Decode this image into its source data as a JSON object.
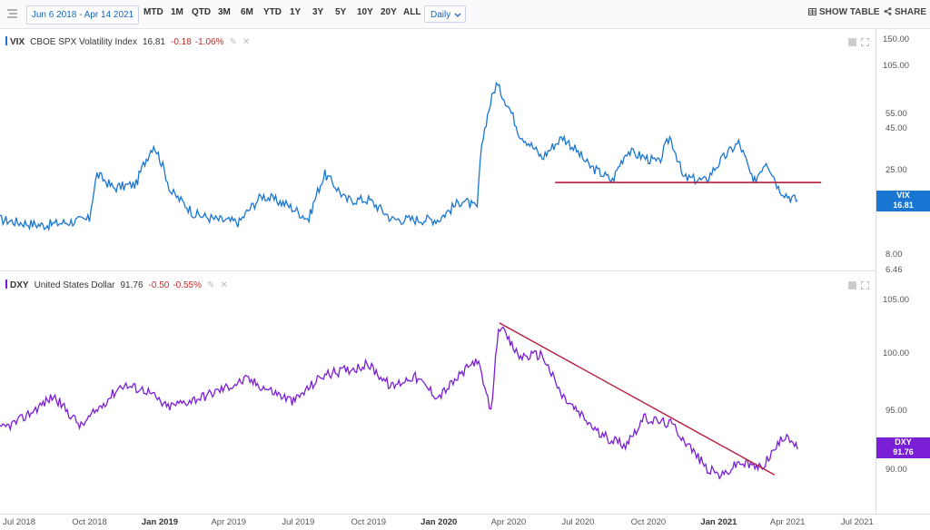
{
  "toolbar": {
    "date_range": "Jun 6 2018 - Apr 14 2021",
    "ranges": [
      "MTD",
      "1M",
      "QTD",
      "3M",
      "6M",
      "YTD",
      "1Y",
      "3Y",
      "5Y",
      "10Y",
      "20Y",
      "ALL"
    ],
    "interval": "Daily",
    "show_table": "SHOW TABLE",
    "share": "SHARE"
  },
  "colors": {
    "vix": "#1976d2",
    "dxy": "#7b1fd6",
    "trendline": "#b71c3c",
    "negative": "#c62828"
  },
  "vix": {
    "symbol": "VIX",
    "name": "CBOE SPX Volatility Index",
    "value": "16.81",
    "change": "-0.18",
    "change_pct": "-1.06%",
    "badge_symbol": "VIX",
    "badge_value": "16.81"
  },
  "dxy": {
    "symbol": "DXY",
    "name": "United States Dollar",
    "value": "91.76",
    "change": "-0.50",
    "change_pct": "-0.55%",
    "badge_symbol": "DXY",
    "badge_value": "91.76"
  },
  "y_ticks_top": [
    "150.00",
    "105.00",
    "55.00",
    "45.00",
    "25.00",
    "8.00",
    "6.46"
  ],
  "y_ticks_bottom": [
    "105.00",
    "100.00",
    "95.00",
    "90.00"
  ],
  "x_ticks": [
    {
      "label": "Jul 2018",
      "bold": false
    },
    {
      "label": "Oct 2018",
      "bold": false
    },
    {
      "label": "Jan 2019",
      "bold": true
    },
    {
      "label": "Apr 2019",
      "bold": false
    },
    {
      "label": "Jul 2019",
      "bold": false
    },
    {
      "label": "Oct 2019",
      "bold": false
    },
    {
      "label": "Jan 2020",
      "bold": true
    },
    {
      "label": "Apr 2020",
      "bold": false
    },
    {
      "label": "Jul 2020",
      "bold": false
    },
    {
      "label": "Oct 2020",
      "bold": false
    },
    {
      "label": "Jan 2021",
      "bold": true
    },
    {
      "label": "Apr 2021",
      "bold": false
    },
    {
      "label": "Jul 2021",
      "bold": false
    }
  ],
  "chart_data": [
    {
      "type": "line",
      "title": "VIX CBOE SPX Volatility Index",
      "yscale": "log",
      "ylim": [
        6.46,
        150
      ],
      "x_range": [
        "2018-06-06",
        "2021-04-14"
      ],
      "series": [
        {
          "name": "VIX",
          "points": [
            [
              "2018-06-06",
              13
            ],
            [
              "2018-07-01",
              12.5
            ],
            [
              "2018-08-01",
              12
            ],
            [
              "2018-09-01",
              12.5
            ],
            [
              "2018-10-01",
              13
            ],
            [
              "2018-10-11",
              24
            ],
            [
              "2018-11-01",
              20
            ],
            [
              "2018-12-01",
              21
            ],
            [
              "2018-12-24",
              36
            ],
            [
              "2019-01-15",
              19
            ],
            [
              "2019-02-15",
              14
            ],
            [
              "2019-03-15",
              13
            ],
            [
              "2019-04-15",
              12.5
            ],
            [
              "2019-05-15",
              18
            ],
            [
              "2019-06-15",
              16
            ],
            [
              "2019-07-15",
              13
            ],
            [
              "2019-08-05",
              24
            ],
            [
              "2019-09-01",
              17
            ],
            [
              "2019-10-01",
              17
            ],
            [
              "2019-11-01",
              13
            ],
            [
              "2019-12-01",
              13
            ],
            [
              "2020-01-01",
              13
            ],
            [
              "2020-02-01",
              17
            ],
            [
              "2020-02-20",
              15
            ],
            [
              "2020-02-28",
              40
            ],
            [
              "2020-03-16",
              82
            ],
            [
              "2020-04-15",
              42
            ],
            [
              "2020-05-15",
              30
            ],
            [
              "2020-06-11",
              40
            ],
            [
              "2020-07-15",
              27
            ],
            [
              "2020-08-15",
              22
            ],
            [
              "2020-09-03",
              33
            ],
            [
              "2020-10-15",
              28
            ],
            [
              "2020-10-29",
              40
            ],
            [
              "2020-11-15",
              23
            ],
            [
              "2020-12-15",
              22
            ],
            [
              "2021-01-27",
              37
            ],
            [
              "2021-02-15",
              21
            ],
            [
              "2021-03-04",
              29
            ],
            [
              "2021-03-20",
              20
            ],
            [
              "2021-04-01",
              18
            ],
            [
              "2021-04-14",
              16.81
            ]
          ]
        }
      ],
      "horizontal_line": {
        "y": 21.5,
        "from": "2020-06-01",
        "to": "2021-05-15"
      },
      "last": 16.81
    },
    {
      "type": "line",
      "title": "DXY United States Dollar",
      "ylim": [
        87,
        106.5
      ],
      "x_range": [
        "2018-06-06",
        "2021-04-14"
      ],
      "series": [
        {
          "name": "DXY",
          "points": [
            [
              "2018-06-06",
              93.5
            ],
            [
              "2018-07-01",
              94.3
            ],
            [
              "2018-08-15",
              96.5
            ],
            [
              "2018-09-20",
              93.8
            ],
            [
              "2018-11-12",
              97.5
            ],
            [
              "2018-12-15",
              97
            ],
            [
              "2019-01-10",
              95.5
            ],
            [
              "2019-03-01",
              96.5
            ],
            [
              "2019-04-25",
              98
            ],
            [
              "2019-06-25",
              96
            ],
            [
              "2019-08-01",
              98.3
            ],
            [
              "2019-10-01",
              99.3
            ],
            [
              "2019-10-31",
              97.3
            ],
            [
              "2019-11-29",
              98.3
            ],
            [
              "2019-12-31",
              96.4
            ],
            [
              "2020-02-20",
              99.8
            ],
            [
              "2020-03-09",
              95
            ],
            [
              "2020-03-19",
              102.8
            ],
            [
              "2020-04-15",
              100
            ],
            [
              "2020-05-15",
              100.2
            ],
            [
              "2020-06-10",
              96.5
            ],
            [
              "2020-07-31",
              93
            ],
            [
              "2020-09-01",
              92.2
            ],
            [
              "2020-09-25",
              94.5
            ],
            [
              "2020-11-01",
              94
            ],
            [
              "2020-12-17",
              90
            ],
            [
              "2021-01-06",
              89.4
            ],
            [
              "2021-01-27",
              90.6
            ],
            [
              "2021-02-25",
              90.1
            ],
            [
              "2021-03-31",
              93.2
            ],
            [
              "2021-04-14",
              91.76
            ]
          ]
        }
      ],
      "trend_line": [
        [
          "2020-03-20",
          103
        ],
        [
          "2021-03-15",
          89.5
        ]
      ],
      "last": 91.76
    }
  ]
}
